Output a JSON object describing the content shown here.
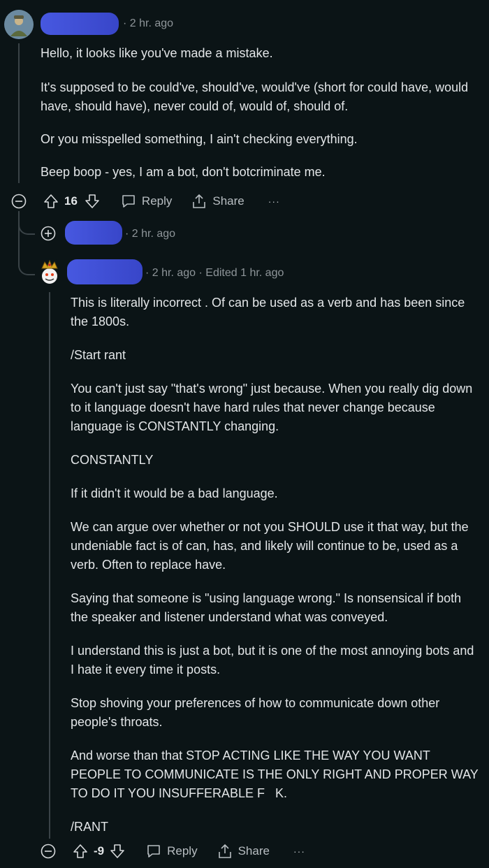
{
  "comment1": {
    "time": "2 hr. ago",
    "paragraphs": [
      "Hello, it looks like you've made a mistake.",
      "It's supposed to be could've, should've, would've (short for could have, would have, should have), never could of, would of, should of.",
      "Or you misspelled something, I ain't checking everything.",
      "Beep boop - yes, I am a bot, don't botcriminate me."
    ],
    "score": "16",
    "reply_label": "Reply",
    "share_label": "Share",
    "more": "···"
  },
  "comment2": {
    "time": "2 hr. ago"
  },
  "comment3": {
    "time": "2 hr. ago",
    "edited": "Edited 1 hr. ago",
    "paragraphs": [
      "This is literally incorrect . Of can be used as a verb and has been since the 1800s.",
      "/Start rant",
      "You can't just say \"that's wrong\" just because. When you really dig down to it language doesn't have hard rules that never change because language is CONSTANTLY changing.",
      "CONSTANTLY",
      "If it didn't it would be a bad language.",
      "We can argue over whether or not you SHOULD use it that way, but the undeniable fact is of can, has, and likely will continue to be, used as a verb. Often to replace have.",
      "Saying that someone is \"using language wrong.\" Is nonsensical if both the speaker and listener understand what was conveyed.",
      "I understand this is just a bot, but it is one of the most annoying bots and I hate it every time it posts.",
      "Stop shoving your preferences of how to communicate down other people's throats.",
      "And worse than that STOP ACTING LIKE THE WAY YOU WANT PEOPLE TO COMMUNICATE IS THE ONLY RIGHT AND PROPER WAY TO DO IT YOU INSUFFERABLE F   K.",
      "/RANT"
    ],
    "score": "-9",
    "reply_label": "Reply",
    "share_label": "Share",
    "more": "···"
  },
  "colors": {
    "background": "#0b1416",
    "redaction": "#4758e0",
    "meta": "#8e9599"
  }
}
